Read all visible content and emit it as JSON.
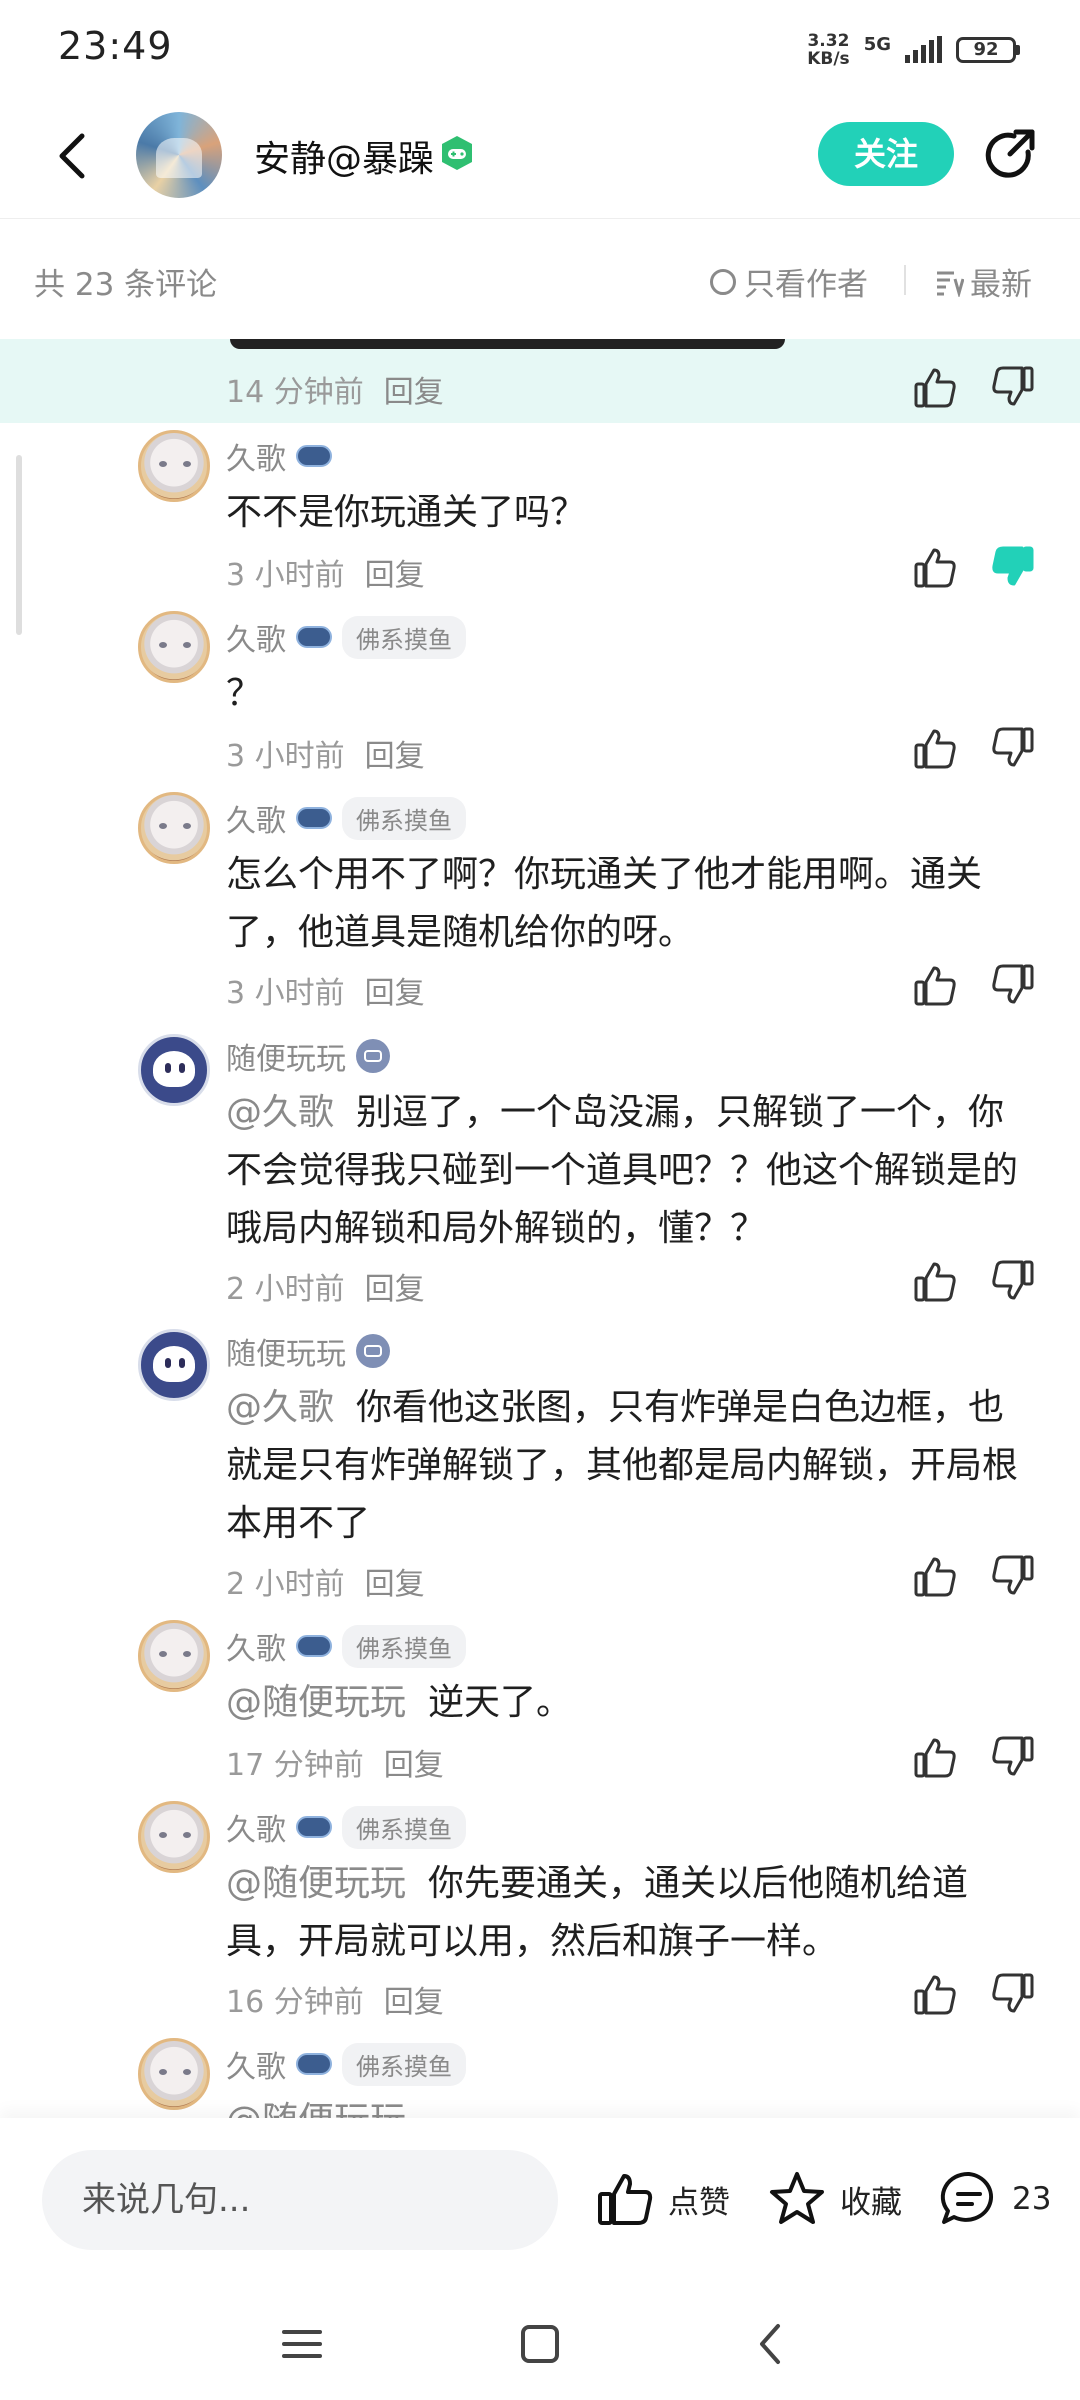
{
  "status_bar": {
    "time": "23:49",
    "net_speed_value": "3.32",
    "net_speed_unit": "KB/s",
    "network": "5G",
    "battery": "92"
  },
  "header": {
    "author_name": "安静@暴躁",
    "follow_label": "关注"
  },
  "comments_bar": {
    "count_text": "共 23 条评论",
    "author_only_label": "只看作者",
    "sort_label": "最新"
  },
  "highlighted": {
    "time": "14 分钟前",
    "reply_label": "回复"
  },
  "replies": [
    {
      "user": "久歌",
      "tag": "",
      "text_mention": "",
      "text": "不不是你玩通关了吗？",
      "time": "3 小时前",
      "reply_label": "回复",
      "disliked": true
    },
    {
      "user": "久歌",
      "tag": "佛系摸鱼",
      "text_mention": "",
      "text": "？",
      "time": "3 小时前",
      "reply_label": "回复",
      "disliked": false
    },
    {
      "user": "久歌",
      "tag": "佛系摸鱼",
      "text_mention": "",
      "text": "怎么个用不了啊？你玩通关了他才能用啊。通关了，他道具是随机给你的呀。",
      "time": "3 小时前",
      "reply_label": "回复",
      "disliked": false
    },
    {
      "user": "随便玩玩",
      "tag": "",
      "text_mention": "@久歌",
      "text": "别逗了，一个岛没漏，只解锁了一个，你不会觉得我只碰到一个道具吧？？他这个解锁是的哦局内解锁和局外解锁的，懂？？",
      "time": "2 小时前",
      "reply_label": "回复",
      "disliked": false
    },
    {
      "user": "随便玩玩",
      "tag": "",
      "text_mention": "@久歌",
      "text": "你看他这张图，只有炸弹是白色边框，也就是只有炸弹解锁了，其他都是局内解锁，开局根本用不了",
      "time": "2 小时前",
      "reply_label": "回复",
      "disliked": false
    },
    {
      "user": "久歌",
      "tag": "佛系摸鱼",
      "text_mention": "@随便玩玩",
      "text": "逆天了。",
      "time": "17 分钟前",
      "reply_label": "回复",
      "disliked": false
    },
    {
      "user": "久歌",
      "tag": "佛系摸鱼",
      "text_mention": "@随便玩玩",
      "text": "你先要通关，通关以后他随机给道具，开局就可以用，然后和旗子一样。",
      "time": "16 分钟前",
      "reply_label": "回复",
      "disliked": false
    },
    {
      "user": "久歌",
      "tag": "佛系摸鱼",
      "text_mention": "@随便玩玩",
      "text": "",
      "time": "",
      "reply_label": "",
      "disliked": false
    }
  ],
  "bottom_bar": {
    "input_placeholder": "来说几句...",
    "like_label": "点赞",
    "favorite_label": "收藏",
    "comment_count": "23"
  },
  "colors": {
    "accent": "#22d1b8",
    "highlight_bg": "#e6f8f5",
    "muted_text": "#8a8a8a"
  },
  "icons": {
    "back": "back-arrow-icon",
    "share": "share-icon",
    "like": "thumbs-up-icon",
    "dislike": "thumbs-down-icon",
    "favorite": "star-icon",
    "comment": "chat-bubble-icon",
    "sort": "sort-lines-icon"
  }
}
